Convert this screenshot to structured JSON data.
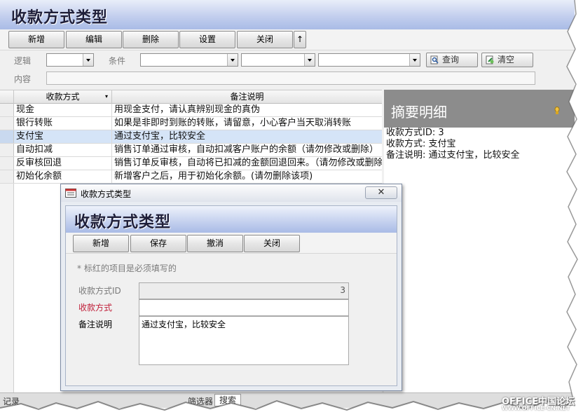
{
  "window": {
    "title": "收款方式类型"
  },
  "toolbar": {
    "buttons": [
      "新增",
      "编辑",
      "删除",
      "设置",
      "关闭",
      "↑"
    ]
  },
  "filter": {
    "logic_label": "逻辑",
    "condition_label": "条件",
    "content_label": "内容",
    "query_button": "查询",
    "clear_button": "清空"
  },
  "grid": {
    "columns": [
      "收款方式",
      "备注说明"
    ],
    "rows": [
      {
        "method": "现金",
        "note": "用现金支付，请认真辨别现金的真伪"
      },
      {
        "method": "银行转账",
        "note": "如果是非即时到账的转账，请留意，小心客户当天取消转账"
      },
      {
        "method": "支付宝",
        "note": "通过支付宝，比较安全"
      },
      {
        "method": "自动扣减",
        "note": "销售订单通过审核，自动扣减客户账户的余额（请勿修改或删除）"
      },
      {
        "method": "反审核回退",
        "note": "销售订单反审核，自动将已扣减的金额回退回来。（请勿修改或删除）"
      },
      {
        "method": "初始化余额",
        "note": "新增客户之后，用于初始化余额。(请勿删除该项)"
      }
    ],
    "selected_index": 2
  },
  "detail": {
    "title": "摘要明细",
    "lines": [
      "收款方式ID: 3",
      "收款方式: 支付宝",
      "备注说明: 通过支付宝，比较安全"
    ]
  },
  "statusbar": {
    "record": "记录",
    "filter": "筛选器",
    "search": "搜索"
  },
  "dialog": {
    "caption": "收款方式类型",
    "close_symbol": "✕",
    "title": "收款方式类型",
    "buttons": [
      "新增",
      "保存",
      "撤消",
      "关闭"
    ],
    "note": "* 标红的项目是必须填写的",
    "fields": {
      "id_label": "收款方式ID",
      "id_value": "3",
      "method_label": "收款方式",
      "method_value": "",
      "remark_label": "备注说明",
      "remark_value": "通过支付宝，比较安全"
    }
  },
  "watermark": {
    "line1": "OFFICE中国论坛",
    "line2": "WWW.OFFICE-CN.NET"
  },
  "colors": {
    "selected_row": "#d5e4f7",
    "required_label": "#c0203a",
    "detail_header": "#8c8c8c"
  }
}
